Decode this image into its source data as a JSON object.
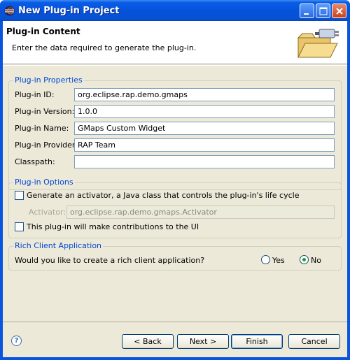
{
  "window": {
    "title": "New Plug-in Project"
  },
  "banner": {
    "title": "Plug-in Content",
    "description": "Enter the data required to generate the plug-in."
  },
  "properties": {
    "group_title": "Plug-in Properties",
    "id_label": "Plug-in ID:",
    "id_value": "org.eclipse.rap.demo.gmaps",
    "version_label": "Plug-in Version:",
    "version_value": "1.0.0",
    "name_label": "Plug-in Name:",
    "name_value": "GMaps Custom Widget",
    "provider_label": "Plug-in Provider:",
    "provider_value": "RAP Team",
    "classpath_label": "Classpath:",
    "classpath_value": ""
  },
  "options": {
    "group_title": "Plug-in Options",
    "activator_check_label": "Generate an activator, a Java class that controls the plug-in's life cycle",
    "activator_label": "Activator:",
    "activator_value": "org.eclipse.rap.demo.gmaps.Activator",
    "ui_check_label": "This plug-in will make contributions to the UI"
  },
  "rcp": {
    "group_title": "Rich Client Application",
    "question": "Would you like to create a rich client application?",
    "yes_label": "Yes",
    "no_label": "No",
    "selected": "No"
  },
  "buttons": {
    "back": "< Back",
    "next": "Next >",
    "finish": "Finish",
    "cancel": "Cancel"
  },
  "icons": {
    "app": "eclipse-icon",
    "help": "help-icon",
    "banner": "plugin-folder-icon"
  },
  "colors": {
    "titlebar": "#0553da",
    "group_title": "#0046d5",
    "dialog_bg": "#ece9d8"
  }
}
